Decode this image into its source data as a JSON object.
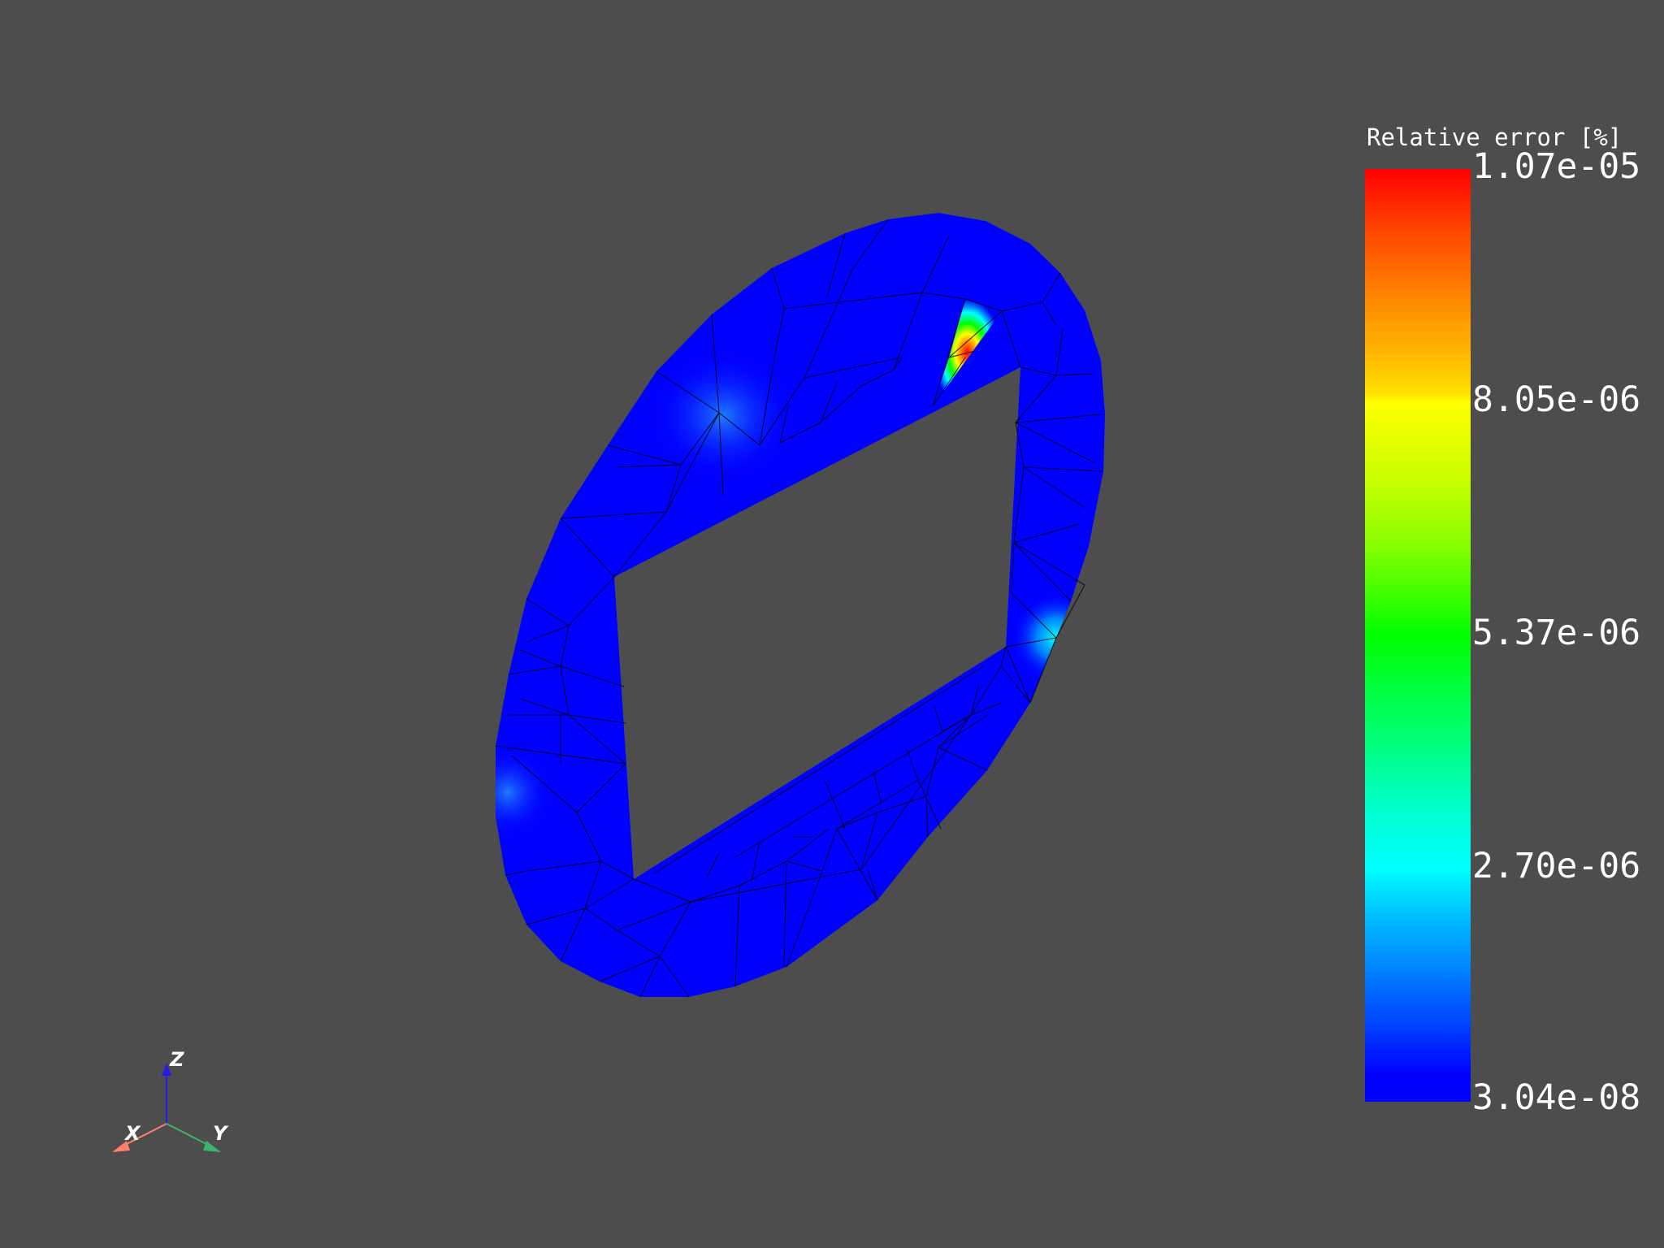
{
  "scalar_bar": {
    "title": "Relative error [%]",
    "labels": [
      "1.07e-05",
      "8.05e-06",
      "5.37e-06",
      "2.70e-06",
      "3.04e-08"
    ],
    "min": 3.04e-08,
    "max": 1.07e-05,
    "colormap": [
      "#0000ff",
      "#00ffff",
      "#00ff00",
      "#ffff00",
      "#ff0000"
    ]
  },
  "axes": {
    "x": "X",
    "y": "Y",
    "z": "Z"
  },
  "colors": {
    "background": "#4d4d4d",
    "mesh_base": "#0000ff",
    "mesh_edges": "#000000",
    "x_axis": "#ff7f6e",
    "y_axis": "#3cb371",
    "z_axis": "#1e1ee6"
  }
}
